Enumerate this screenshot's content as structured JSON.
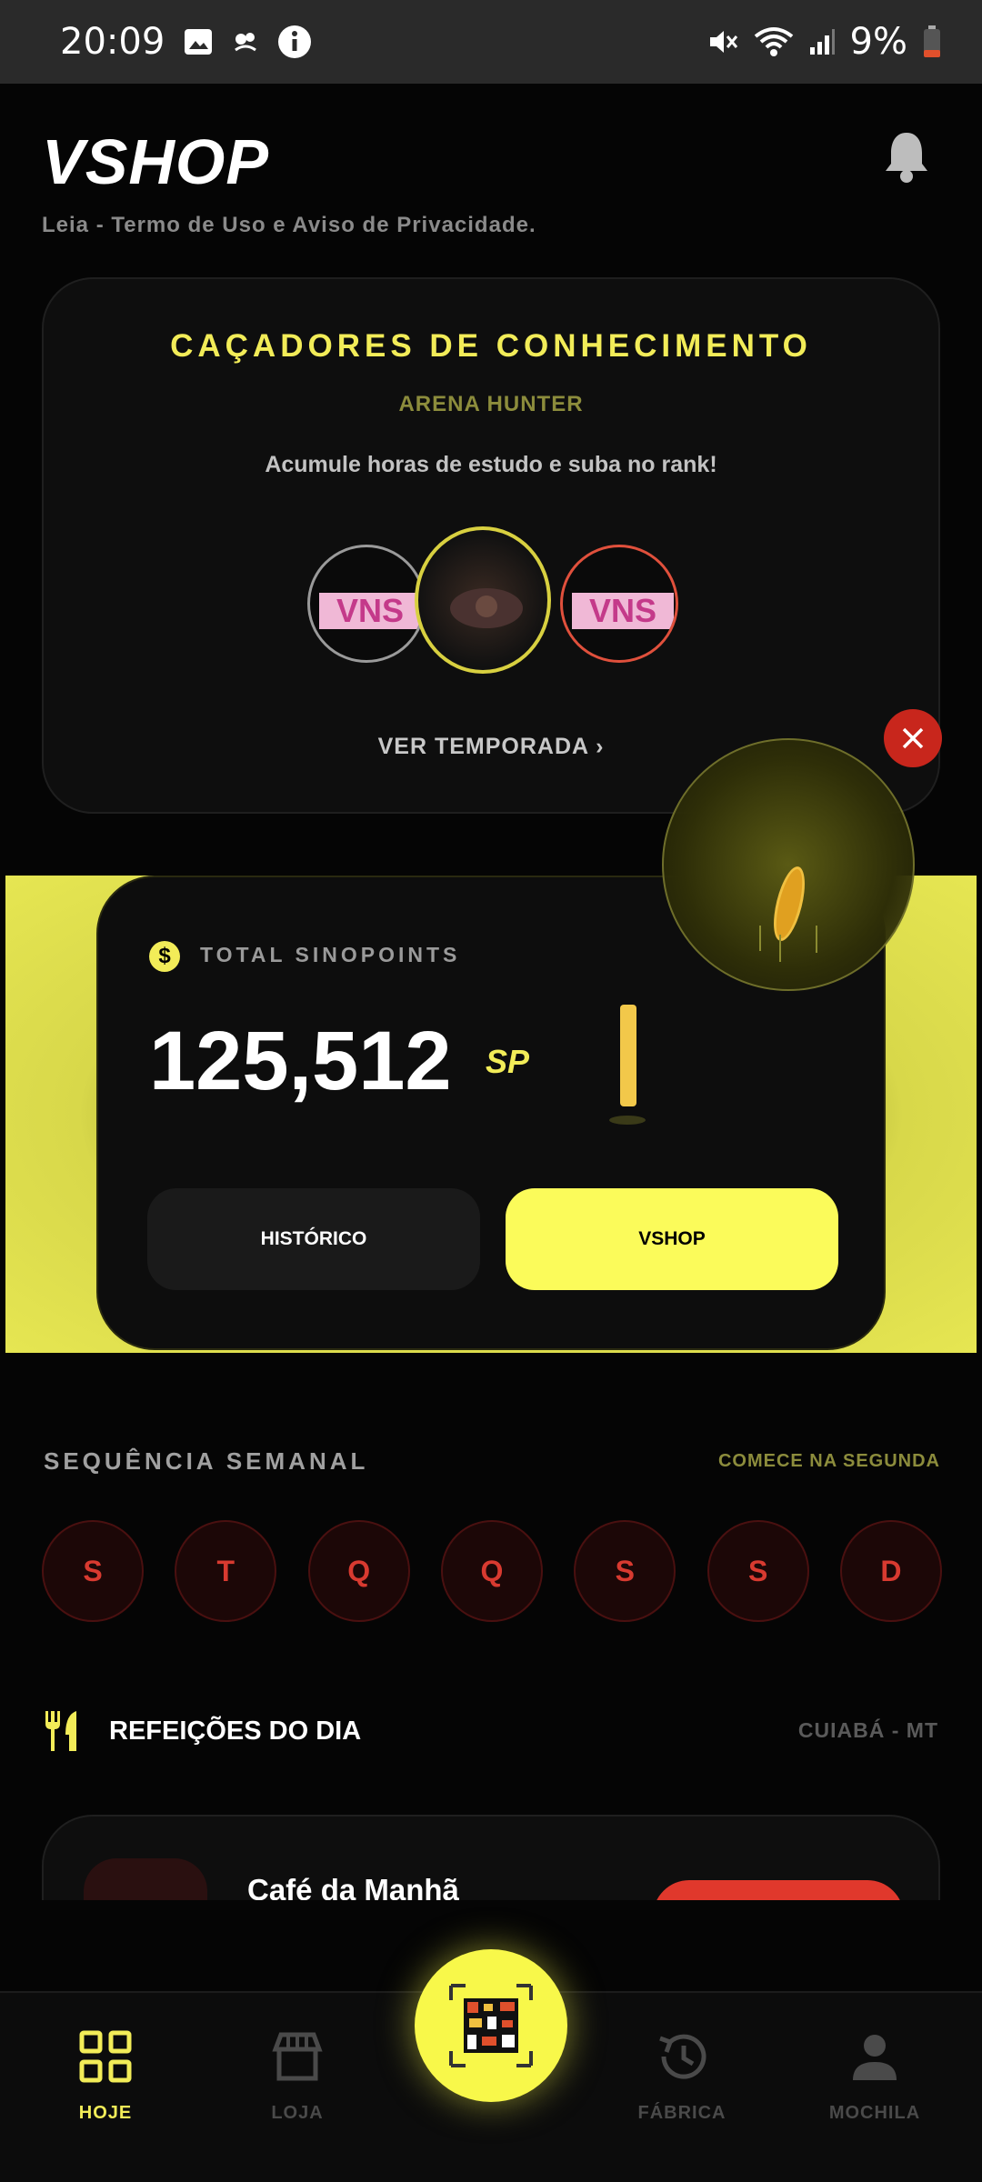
{
  "statusbar": {
    "time": "20:09",
    "battery": "9%"
  },
  "header": {
    "title": "VSHOP",
    "terms": "Leia - Termo de Uso e Aviso de Privacidade."
  },
  "season_card": {
    "title": "CAÇADORES DE CONHECIMENTO",
    "subtitle": "ARENA HUNTER",
    "description": "Acumule horas de estudo e suba no rank!",
    "avatars": [
      {
        "label": "VNS"
      },
      {
        "label": ""
      },
      {
        "label": "VNS"
      }
    ],
    "link": "VER TEMPORADA"
  },
  "points": {
    "label": "TOTAL SINOPOINTS",
    "value": "125,512",
    "unit": "SP",
    "history_label": "HISTÓRICO",
    "shop_label": "VSHOP"
  },
  "week": {
    "title": "SEQUÊNCIA SEMANAL",
    "hint": "COMECE NA SEGUNDA",
    "days": [
      "S",
      "T",
      "Q",
      "Q",
      "S",
      "S",
      "D"
    ]
  },
  "meals": {
    "title": "REFEIÇÕES DO DIA",
    "location": "CUIABÁ - MT",
    "first_meal": "Café da Manhã"
  },
  "nav": {
    "today": "HOJE",
    "store": "LOJA",
    "factory": "FÁBRICA",
    "backpack": "MOCHILA"
  },
  "colors": {
    "accent": "#f2ec58",
    "danger": "#d83a30",
    "background": "#050505"
  }
}
